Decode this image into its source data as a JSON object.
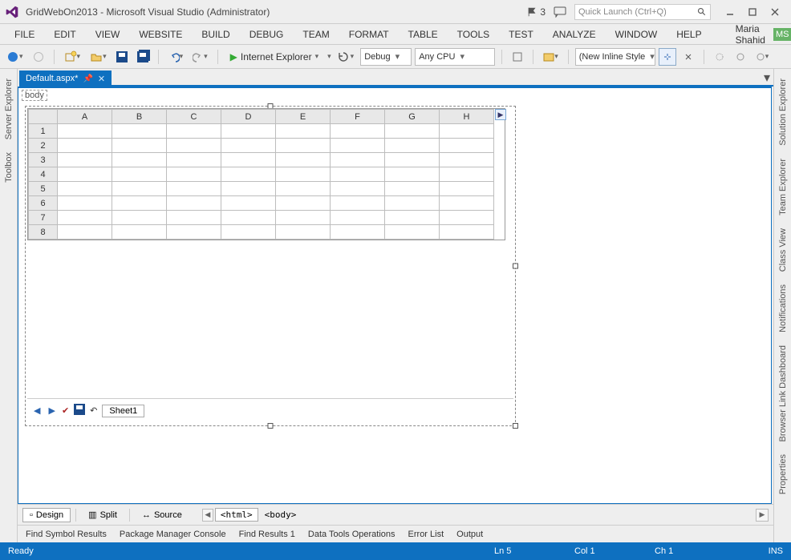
{
  "title": "GridWebOn2013 - Microsoft Visual Studio (Administrator)",
  "notifications": {
    "flag_count": "3"
  },
  "quick_launch": {
    "placeholder": "Quick Launch (Ctrl+Q)"
  },
  "menus": [
    "FILE",
    "EDIT",
    "VIEW",
    "WEBSITE",
    "BUILD",
    "DEBUG",
    "TEAM",
    "FORMAT",
    "TABLE",
    "TOOLS",
    "TEST",
    "ANALYZE",
    "WINDOW",
    "HELP"
  ],
  "user": {
    "name": "Maria Shahid",
    "initials": "MS"
  },
  "toolbar": {
    "browser_label": "Internet Explorer",
    "config": "Debug",
    "platform": "Any CPU",
    "style_ddl": "(New Inline Style"
  },
  "doc_tab": {
    "label": "Default.aspx*"
  },
  "designer": {
    "body_tag": "body"
  },
  "grid": {
    "columns": [
      "A",
      "B",
      "C",
      "D",
      "E",
      "F",
      "G",
      "H"
    ],
    "rows": [
      "1",
      "2",
      "3",
      "4",
      "5",
      "6",
      "7",
      "8"
    ],
    "sheet": "Sheet1"
  },
  "view_tabs": {
    "design": "Design",
    "split": "Split",
    "source": "Source"
  },
  "breadcrumb": [
    "<html>",
    "<body>"
  ],
  "bottom_tabs": [
    "Find Symbol Results",
    "Package Manager Console",
    "Find Results 1",
    "Data Tools Operations",
    "Error List",
    "Output"
  ],
  "status": {
    "ready": "Ready",
    "ln": "Ln 5",
    "col": "Col 1",
    "ch": "Ch 1",
    "ins": "INS"
  },
  "side_left": [
    "Server Explorer",
    "Toolbox"
  ],
  "side_right": [
    "Solution Explorer",
    "Team Explorer",
    "Class View",
    "Notifications",
    "Browser Link Dashboard",
    "Properties"
  ]
}
